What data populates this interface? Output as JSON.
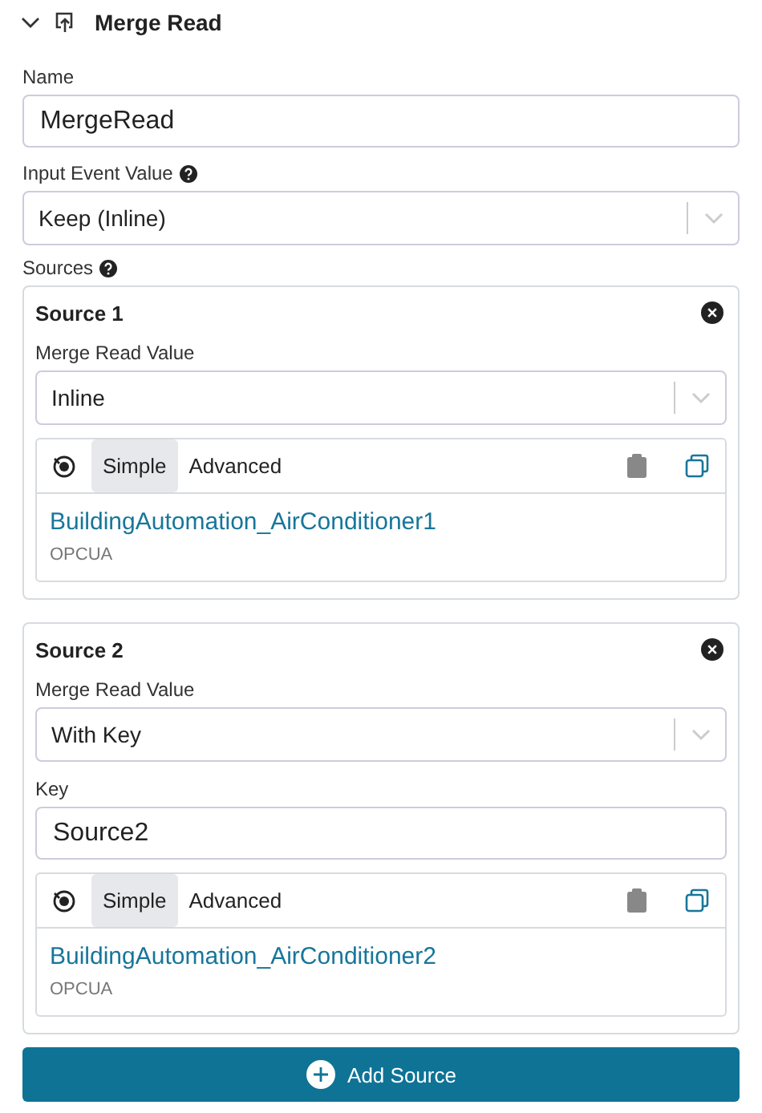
{
  "header": {
    "title": "Merge Read",
    "expanded": true
  },
  "name_field": {
    "label": "Name",
    "value": "MergeRead"
  },
  "input_event": {
    "label": "Input Event Value",
    "value": "Keep (Inline)"
  },
  "sources_label": "Sources",
  "sources": [
    {
      "title": "Source 1",
      "merge_label": "Merge Read Value",
      "merge_value": "Inline",
      "tabs": [
        {
          "label": "Simple",
          "selected": true
        },
        {
          "label": "Advanced",
          "selected": false
        }
      ],
      "node": "BuildingAutomation_AirConditioner1",
      "protocol": "OPCUA"
    },
    {
      "title": "Source 2",
      "merge_label": "Merge Read Value",
      "merge_value": "With Key",
      "key_label": "Key",
      "key_value": "Source2",
      "tabs": [
        {
          "label": "Simple",
          "selected": true
        },
        {
          "label": "Advanced",
          "selected": false
        }
      ],
      "node": "BuildingAutomation_AirConditioner2",
      "protocol": "OPCUA"
    }
  ],
  "add_button": "Add Source"
}
